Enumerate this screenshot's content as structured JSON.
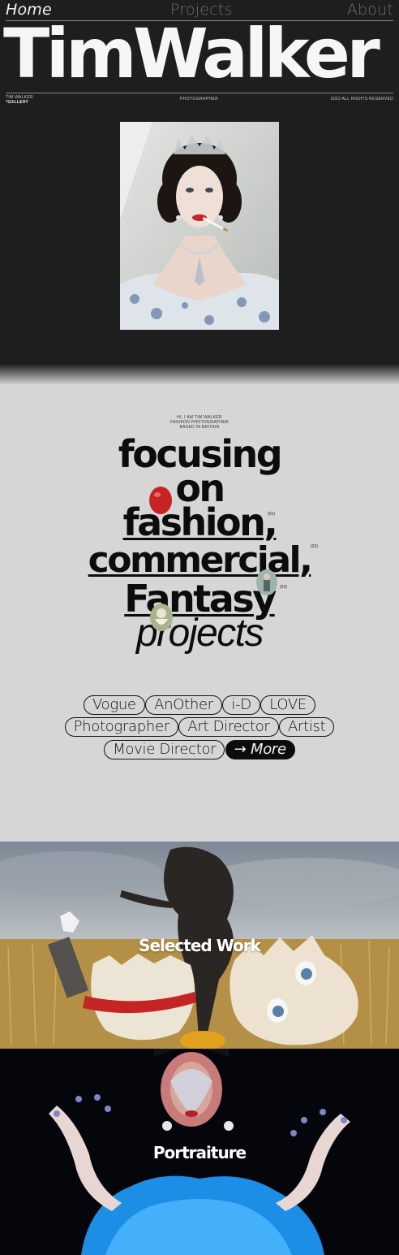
{
  "nav": {
    "home": "Home",
    "projects": "Projects",
    "about": "About"
  },
  "brand": "TimWalker",
  "meta": {
    "name": "TIM WALKER",
    "tag": "*GALLERY",
    "role": "PHOTOGRAPHER",
    "rights": "2023 ALL RIGHTS RESERVED"
  },
  "intro": {
    "hi": [
      "HI, I AM TIM WALKER",
      "FASHION PHOTOGRAPHER",
      "BASED IN BRITAIN"
    ],
    "line1": "focusing",
    "line2": "on",
    "line3": "fashion,",
    "line4": "commercial,",
    "line5": "Fantasy",
    "line6": "projects",
    "n1": "(01)",
    "n2": "(02)",
    "n3": "(03)"
  },
  "tags": {
    "row1": [
      "Vogue",
      "AnOther",
      "i-D",
      "LOVE"
    ],
    "row2": [
      "Photographer",
      "Art Director",
      "Artist"
    ],
    "row3": [
      "Movie Director"
    ],
    "more": "→  More"
  },
  "sections": {
    "selected": "Selected Work",
    "portraiture": "Portraiture"
  },
  "colors": {
    "dark": "#1e1e1e",
    "light": "#d6d6d6",
    "ink": "#0c0c0c"
  }
}
